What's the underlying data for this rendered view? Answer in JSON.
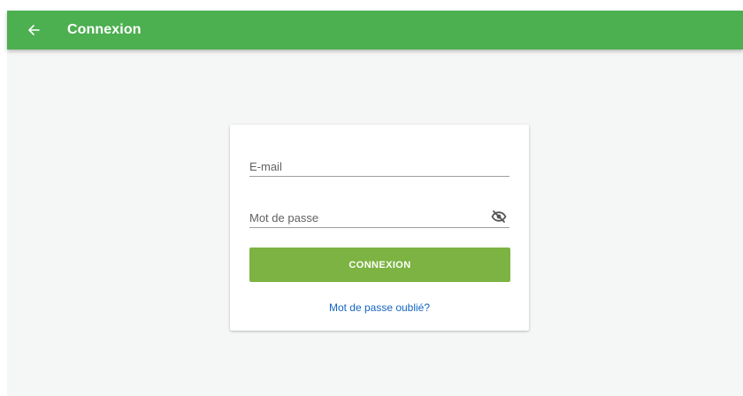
{
  "header": {
    "title": "Connexion",
    "back_icon": "arrow-left-icon",
    "background": "#4caf50"
  },
  "form": {
    "email_placeholder": "E-mail",
    "email_value": "",
    "password_placeholder": "Mot de passe",
    "password_value": "",
    "password_toggle_icon": "eye-off-icon",
    "submit_label": "CONNEXION",
    "submit_color": "#7cb342",
    "forgot_label": "Mot de passe oublié?",
    "link_color": "#1565c0"
  }
}
